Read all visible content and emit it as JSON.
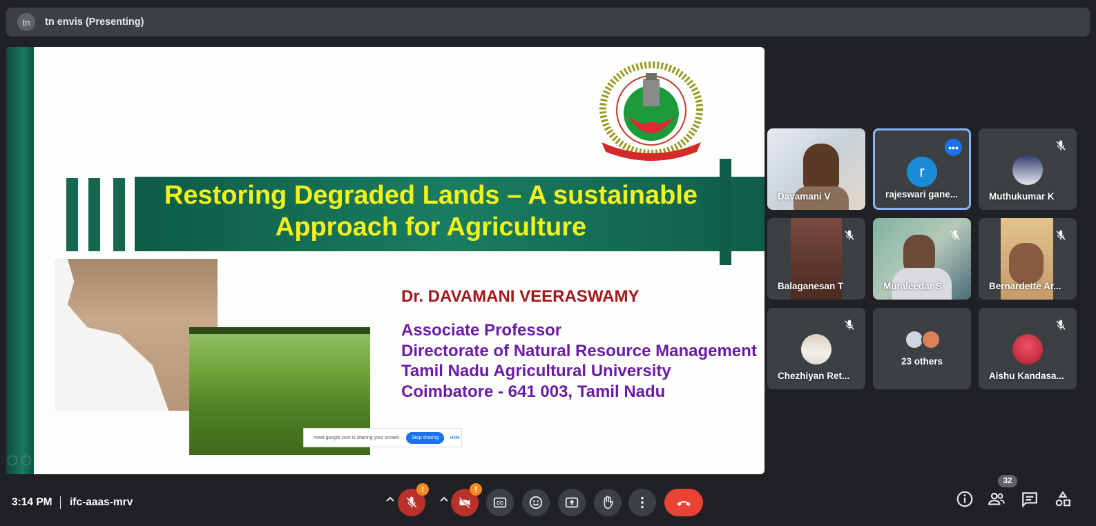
{
  "header": {
    "presenter_initials": "tn",
    "title": "tn envis (Presenting)"
  },
  "slide": {
    "title_line1": "Restoring Degraded Lands – A sustainable",
    "title_line2": "Approach for Agriculture",
    "author": "Dr. DAVAMANI VEERASWAMY",
    "affiliation": [
      "Associate Professor",
      "Directorate of Natural Resource Management",
      "Tamil Nadu Agricultural University",
      "Coimbatore - 641 003, Tamil Nadu"
    ],
    "share_notice": "meet.google.com is sharing your screen.",
    "stop_sharing": "Stop sharing",
    "hide": "Hide"
  },
  "participants": [
    {
      "name": "Davamani V",
      "muted": false
    },
    {
      "name": "rajeswari gane...",
      "initial": "r",
      "muted": false
    },
    {
      "name": "Muthukumar K",
      "muted": true
    },
    {
      "name": "Balaganesan T",
      "muted": true
    },
    {
      "name": "Muraleedar S",
      "muted": true
    },
    {
      "name": "Bernardette Ar...",
      "muted": true
    },
    {
      "name": "Chezhiyan Ret...",
      "muted": true
    },
    {
      "name": "23 others"
    },
    {
      "name": "Aishu Kandasa...",
      "muted": true
    }
  ],
  "footer": {
    "time": "3:14 PM",
    "meeting_code": "ifc-aaas-mrv",
    "warn_symbol": "!",
    "participant_count": "32"
  },
  "colors": {
    "accent": "#8ab4f8",
    "end_call": "#ea4335",
    "warning": "#f28b22",
    "headline": "#f3f21b"
  }
}
